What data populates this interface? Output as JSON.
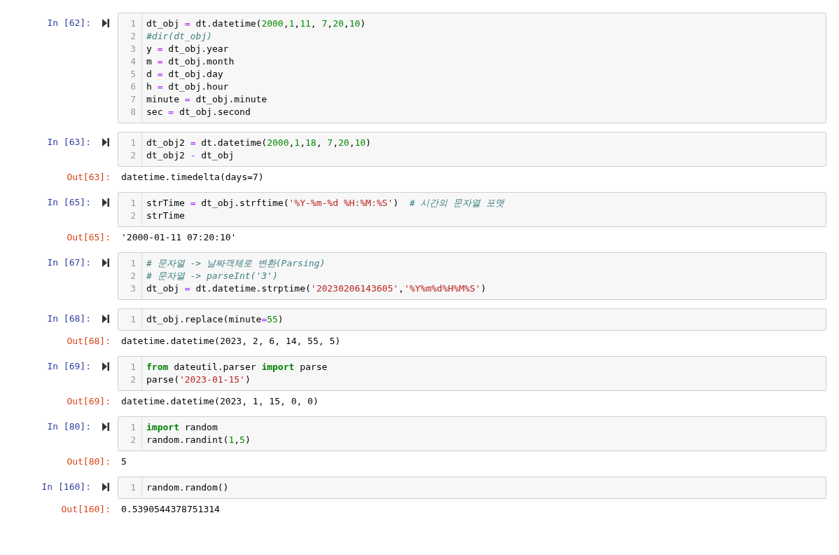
{
  "cells": [
    {
      "prompt": "In [62]:",
      "lines": [
        [
          {
            "kind": "plain",
            "text": "dt_obj "
          },
          {
            "kind": "operator",
            "text": "="
          },
          {
            "kind": "plain",
            "text": " dt.datetime("
          },
          {
            "kind": "number",
            "text": "2000"
          },
          {
            "kind": "plain",
            "text": ","
          },
          {
            "kind": "number",
            "text": "1"
          },
          {
            "kind": "plain",
            "text": ","
          },
          {
            "kind": "number",
            "text": "11"
          },
          {
            "kind": "plain",
            "text": ", "
          },
          {
            "kind": "number",
            "text": "7"
          },
          {
            "kind": "plain",
            "text": ","
          },
          {
            "kind": "number",
            "text": "20"
          },
          {
            "kind": "plain",
            "text": ","
          },
          {
            "kind": "number",
            "text": "10"
          },
          {
            "kind": "plain",
            "text": ")"
          }
        ],
        [
          {
            "kind": "comment",
            "text": "#dir(dt_obj)"
          }
        ],
        [
          {
            "kind": "plain",
            "text": "y "
          },
          {
            "kind": "operator",
            "text": "="
          },
          {
            "kind": "plain",
            "text": " dt_obj.year"
          }
        ],
        [
          {
            "kind": "plain",
            "text": "m "
          },
          {
            "kind": "operator",
            "text": "="
          },
          {
            "kind": "plain",
            "text": " dt_obj.month"
          }
        ],
        [
          {
            "kind": "plain",
            "text": "d "
          },
          {
            "kind": "operator",
            "text": "="
          },
          {
            "kind": "plain",
            "text": " dt_obj.day"
          }
        ],
        [
          {
            "kind": "plain",
            "text": "h "
          },
          {
            "kind": "operator",
            "text": "="
          },
          {
            "kind": "plain",
            "text": " dt_obj.hour"
          }
        ],
        [
          {
            "kind": "plain",
            "text": "minute "
          },
          {
            "kind": "operator",
            "text": "="
          },
          {
            "kind": "plain",
            "text": " dt_obj.minute"
          }
        ],
        [
          {
            "kind": "plain",
            "text": "sec "
          },
          {
            "kind": "operator",
            "text": "="
          },
          {
            "kind": "plain",
            "text": " dt_obj.second"
          }
        ]
      ],
      "line_numbers": [
        "1",
        "2",
        "3",
        "4",
        "5",
        "6",
        "7",
        "8"
      ]
    },
    {
      "prompt": "In [63]:",
      "lines": [
        [
          {
            "kind": "plain",
            "text": "dt_obj2 "
          },
          {
            "kind": "operator",
            "text": "="
          },
          {
            "kind": "plain",
            "text": " dt.datetime("
          },
          {
            "kind": "number",
            "text": "2000"
          },
          {
            "kind": "plain",
            "text": ","
          },
          {
            "kind": "number",
            "text": "1"
          },
          {
            "kind": "plain",
            "text": ","
          },
          {
            "kind": "number",
            "text": "18"
          },
          {
            "kind": "plain",
            "text": ", "
          },
          {
            "kind": "number",
            "text": "7"
          },
          {
            "kind": "plain",
            "text": ","
          },
          {
            "kind": "number",
            "text": "20"
          },
          {
            "kind": "plain",
            "text": ","
          },
          {
            "kind": "number",
            "text": "10"
          },
          {
            "kind": "plain",
            "text": ")"
          }
        ],
        [
          {
            "kind": "plain",
            "text": "dt_obj2 "
          },
          {
            "kind": "operator",
            "text": "-"
          },
          {
            "kind": "plain",
            "text": " dt_obj"
          }
        ]
      ],
      "line_numbers": [
        "1",
        "2"
      ],
      "out_prompt": "Out[63]:",
      "output": "datetime.timedelta(days=7)"
    },
    {
      "prompt": "In [65]:",
      "lines": [
        [
          {
            "kind": "plain",
            "text": "strTime "
          },
          {
            "kind": "operator",
            "text": "="
          },
          {
            "kind": "plain",
            "text": " dt_obj.strftime("
          },
          {
            "kind": "string",
            "text": "'%Y-%m-%d %H:%M:%S'"
          },
          {
            "kind": "plain",
            "text": ")  "
          },
          {
            "kind": "comment",
            "text": "# 시간의 문자열 포맷"
          }
        ],
        [
          {
            "kind": "plain",
            "text": "strTime"
          }
        ]
      ],
      "line_numbers": [
        "1",
        "2"
      ],
      "out_prompt": "Out[65]:",
      "output": "'2000-01-11 07:20:10'"
    },
    {
      "prompt": "In [67]:",
      "lines": [
        [
          {
            "kind": "comment",
            "text": "# 문자열 -> 날짜객체로 변환(Parsing)"
          }
        ],
        [
          {
            "kind": "comment",
            "text": "# 문자열 -> parseInt('3')"
          }
        ],
        [
          {
            "kind": "plain",
            "text": "dt_obj "
          },
          {
            "kind": "operator",
            "text": "="
          },
          {
            "kind": "plain",
            "text": " dt.datetime.strptime("
          },
          {
            "kind": "string",
            "text": "'20230206143605'"
          },
          {
            "kind": "plain",
            "text": ","
          },
          {
            "kind": "string",
            "text": "'%Y%m%d%H%M%S'"
          },
          {
            "kind": "plain",
            "text": ")"
          }
        ]
      ],
      "line_numbers": [
        "1",
        "2",
        "3"
      ]
    },
    {
      "prompt": "In [68]:",
      "lines": [
        [
          {
            "kind": "plain",
            "text": "dt_obj.replace(minute"
          },
          {
            "kind": "operator",
            "text": "="
          },
          {
            "kind": "number",
            "text": "55"
          },
          {
            "kind": "plain",
            "text": ")"
          }
        ]
      ],
      "line_numbers": [
        "1"
      ],
      "out_prompt": "Out[68]:",
      "output": "datetime.datetime(2023, 2, 6, 14, 55, 5)"
    },
    {
      "prompt": "In [69]:",
      "lines": [
        [
          {
            "kind": "keyword",
            "text": "from"
          },
          {
            "kind": "plain",
            "text": " dateutil.parser "
          },
          {
            "kind": "keyword",
            "text": "import"
          },
          {
            "kind": "plain",
            "text": " parse"
          }
        ],
        [
          {
            "kind": "plain",
            "text": "parse("
          },
          {
            "kind": "string",
            "text": "'2023-01-15'"
          },
          {
            "kind": "plain",
            "text": ")"
          }
        ]
      ],
      "line_numbers": [
        "1",
        "2"
      ],
      "out_prompt": "Out[69]:",
      "output": "datetime.datetime(2023, 1, 15, 0, 0)"
    },
    {
      "prompt": "In [80]:",
      "lines": [
        [
          {
            "kind": "keyword",
            "text": "import"
          },
          {
            "kind": "plain",
            "text": " random"
          }
        ],
        [
          {
            "kind": "plain",
            "text": "random.randint("
          },
          {
            "kind": "number",
            "text": "1"
          },
          {
            "kind": "plain",
            "text": ","
          },
          {
            "kind": "number",
            "text": "5"
          },
          {
            "kind": "plain",
            "text": ")"
          }
        ]
      ],
      "line_numbers": [
        "1",
        "2"
      ],
      "out_prompt": "Out[80]:",
      "output": "5"
    },
    {
      "prompt": "In [160]:",
      "lines": [
        [
          {
            "kind": "plain",
            "text": "random.random()"
          }
        ]
      ],
      "line_numbers": [
        "1"
      ],
      "out_prompt": "Out[160]:",
      "output": "0.5390544378751314"
    }
  ]
}
